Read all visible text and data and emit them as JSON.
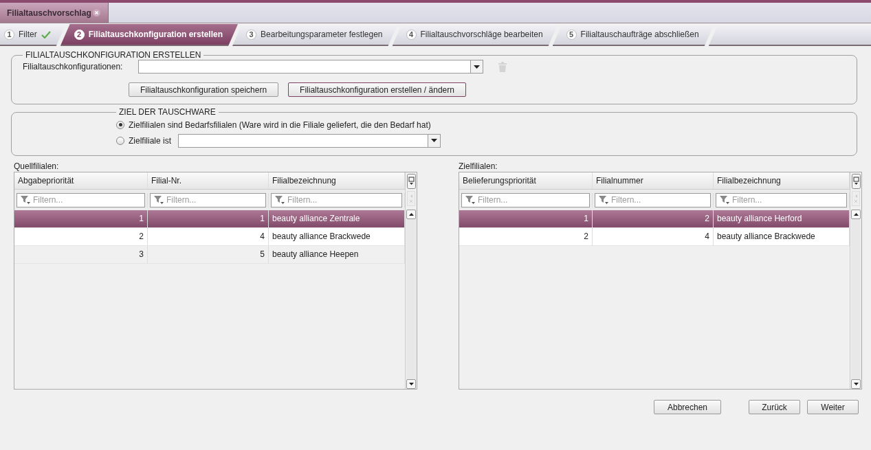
{
  "document_tab": {
    "title": "Filialtauschvorschlag",
    "closable": true
  },
  "steps": [
    {
      "number": "1",
      "label": "Filter",
      "selected": false,
      "done": true
    },
    {
      "number": "2",
      "label": "Filialtauschkonfiguration erstellen",
      "selected": true,
      "done": false
    },
    {
      "number": "3",
      "label": "Bearbeitungsparameter festlegen",
      "selected": false,
      "done": false
    },
    {
      "number": "4",
      "label": "Filialtauschvorschläge bearbeiten",
      "selected": false,
      "done": false
    },
    {
      "number": "5",
      "label": "Filialtauschaufträge abschließen",
      "selected": false,
      "done": false
    }
  ],
  "config_group": {
    "title": "FILIALTAUSCHKONFIGURATION ERSTELLEN",
    "field_label": "Filialtauschkonfigurationen:",
    "delete_disabled": true,
    "buttons": [
      {
        "label": "Filialtauschkonfiguration speichern",
        "focused": false
      },
      {
        "label": "Filialtauschkonfiguration erstellen / ändern",
        "focused": true
      }
    ]
  },
  "target_group": {
    "title": "ZIEL DER TAUSCHWARE",
    "options": [
      {
        "label": "Zielfilialen sind Bedarfsfilialen (Ware wird in die Filiale geliefert, die den Bedarf hat)",
        "selected": true,
        "kind": "plain"
      },
      {
        "label": "Zielfiliale ist",
        "selected": false,
        "kind": "dropdown"
      }
    ]
  },
  "tables": [
    {
      "title": "Quellfilialen:",
      "columns": [
        "Abgabepriorität",
        "Filial-Nr.",
        "Filialbezeichnung"
      ],
      "filter_placeholders": [
        "Filtern...",
        "Filtern...",
        "Filtern..."
      ],
      "rows": [
        {
          "cells": [
            "1",
            "1",
            "beauty alliance Zentrale"
          ],
          "selected": true
        },
        {
          "cells": [
            "2",
            "4",
            "beauty alliance Brackwede"
          ],
          "selected": false
        },
        {
          "cells": [
            "3",
            "5",
            "beauty alliance Heepen"
          ],
          "selected": false
        }
      ]
    },
    {
      "title": "Zielfilialen:",
      "columns": [
        "Belieferungspriorität",
        "Filialnummer",
        "Filialbezeichnung"
      ],
      "filter_placeholders": [
        "Filtern...",
        "Filtern...",
        "Filtern..."
      ],
      "rows": [
        {
          "cells": [
            "1",
            "2",
            "beauty alliance Herford"
          ],
          "selected": true
        },
        {
          "cells": [
            "2",
            "4",
            "beauty alliance Brackwede"
          ],
          "selected": false
        }
      ]
    }
  ],
  "footer_buttons": [
    "Abbrechen",
    "Zurück",
    "Weiter"
  ]
}
